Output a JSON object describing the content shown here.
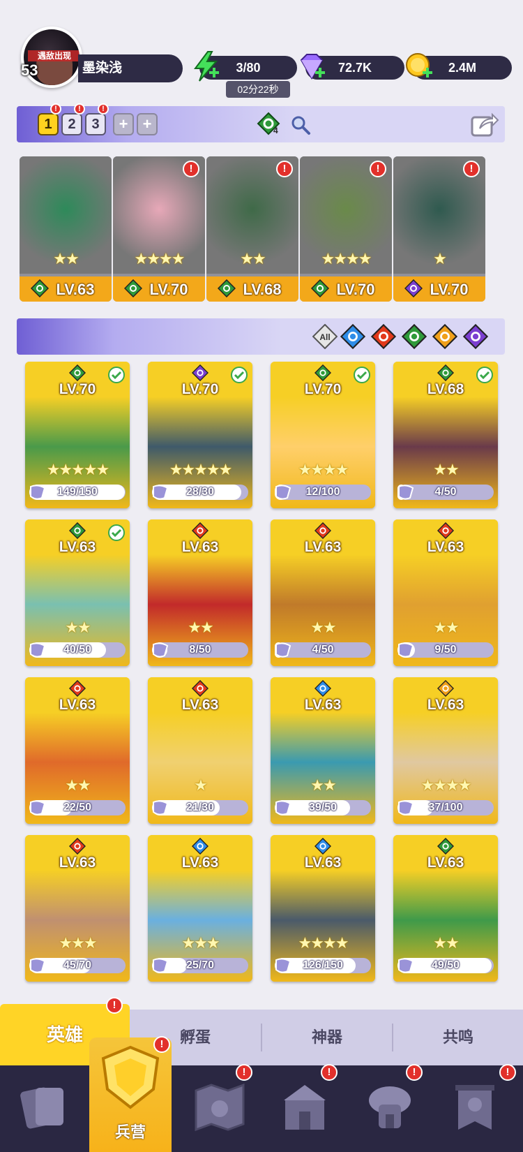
{
  "player": {
    "level": "53",
    "name": "墨染浅",
    "avatar_banner": "遇敌出现"
  },
  "resources": {
    "energy": "3/80",
    "energy_timer": "02分22秒",
    "gems": "72.7K",
    "gold": "2.4M"
  },
  "team_slots": [
    {
      "label": "1",
      "active": true
    },
    {
      "label": "2",
      "active": false
    },
    {
      "label": "3",
      "active": false
    }
  ],
  "element_count": "4",
  "team": [
    {
      "lv": "LV.63",
      "element": "nature",
      "stars": 2,
      "alert": false
    },
    {
      "lv": "LV.70",
      "element": "nature",
      "stars": 4,
      "alert": true
    },
    {
      "lv": "LV.68",
      "element": "nature",
      "stars": 2,
      "alert": true
    },
    {
      "lv": "LV.70",
      "element": "nature",
      "stars": 4,
      "alert": true
    },
    {
      "lv": "LV.70",
      "element": "dark",
      "stars": 1,
      "alert": true
    }
  ],
  "filters": {
    "all_label": "All",
    "elements": [
      "water",
      "fire",
      "nature",
      "light",
      "dark"
    ]
  },
  "heroes": [
    {
      "lv": "LV.70",
      "element": "nature",
      "shards": "149/150",
      "progress": 0.99,
      "stars": 5,
      "ready": true
    },
    {
      "lv": "LV.70",
      "element": "dark",
      "shards": "28/30",
      "progress": 0.93,
      "stars": 5,
      "ready": true
    },
    {
      "lv": "LV.70",
      "element": "nature",
      "shards": "12/100",
      "progress": 0.12,
      "stars": 4,
      "ready": true
    },
    {
      "lv": "LV.68",
      "element": "nature",
      "shards": "4/50",
      "progress": 0.08,
      "stars": 2,
      "ready": true
    },
    {
      "lv": "LV.63",
      "element": "nature",
      "shards": "40/50",
      "progress": 0.8,
      "stars": 2,
      "ready": true
    },
    {
      "lv": "LV.63",
      "element": "fire",
      "shards": "8/50",
      "progress": 0.16,
      "stars": 2,
      "ready": false
    },
    {
      "lv": "LV.63",
      "element": "fire",
      "shards": "4/50",
      "progress": 0.08,
      "stars": 2,
      "ready": false
    },
    {
      "lv": "LV.63",
      "element": "fire",
      "shards": "9/50",
      "progress": 0.18,
      "stars": 2,
      "ready": false
    },
    {
      "lv": "LV.63",
      "element": "fire",
      "shards": "22/50",
      "progress": 0.44,
      "stars": 2,
      "ready": false
    },
    {
      "lv": "LV.63",
      "element": "fire",
      "shards": "21/30",
      "progress": 0.7,
      "stars": 1,
      "ready": false
    },
    {
      "lv": "LV.63",
      "element": "water",
      "shards": "39/50",
      "progress": 0.78,
      "stars": 2,
      "ready": false
    },
    {
      "lv": "LV.63",
      "element": "light",
      "shards": "37/100",
      "progress": 0.37,
      "stars": 4,
      "ready": false
    },
    {
      "lv": "LV.63",
      "element": "fire",
      "shards": "45/70",
      "progress": 0.64,
      "stars": 3,
      "ready": false
    },
    {
      "lv": "LV.63",
      "element": "water",
      "shards": "25/70",
      "progress": 0.36,
      "stars": 3,
      "ready": false
    },
    {
      "lv": "LV.63",
      "element": "water",
      "shards": "126/150",
      "progress": 0.84,
      "stars": 4,
      "ready": false
    },
    {
      "lv": "LV.63",
      "element": "nature",
      "shards": "49/50",
      "progress": 0.98,
      "stars": 2,
      "ready": false
    }
  ],
  "tabs": [
    {
      "label": "英雄",
      "active": true,
      "alert": true
    },
    {
      "label": "孵蛋",
      "active": false,
      "alert": false
    },
    {
      "label": "神器",
      "active": false,
      "alert": false
    },
    {
      "label": "共鸣",
      "active": false,
      "alert": false
    }
  ],
  "nav": {
    "active_label": "兵营"
  },
  "colors": {
    "accent": "#ffd426",
    "panel": "#2e2b45",
    "alert": "#e2302b",
    "water": "#2f8de8",
    "fire": "#e23a1c",
    "nature": "#2f9a3a",
    "light": "#f0a01a",
    "dark": "#7b3fd0"
  }
}
